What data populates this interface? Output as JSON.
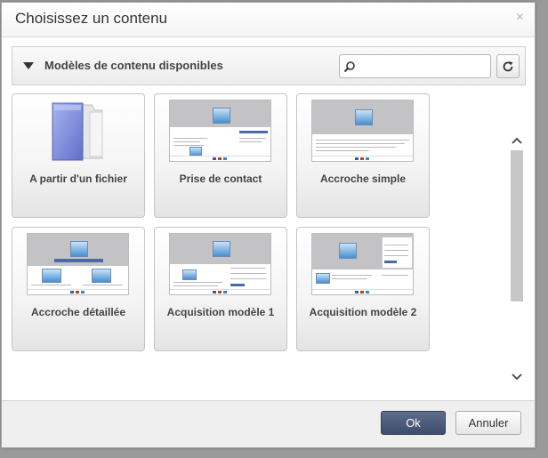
{
  "dialog": {
    "title": "Choisissez un contenu",
    "close_symbol": "×"
  },
  "section": {
    "title": "Modèles de contenu disponibles",
    "search_value": "",
    "search_placeholder": ""
  },
  "templates": [
    {
      "label": "A partir d'un fichier",
      "icon": "folder-icon"
    },
    {
      "label": "Prise de contact",
      "icon": "template-thumbnail"
    },
    {
      "label": "Accroche simple",
      "icon": "template-thumbnail"
    },
    {
      "label": "Accroche détaillée",
      "icon": "template-thumbnail"
    },
    {
      "label": "Acquisition modèle 1",
      "icon": "template-thumbnail"
    },
    {
      "label": "Acquisition modèle 2",
      "icon": "template-thumbnail"
    }
  ],
  "footer": {
    "ok_label": "Ok",
    "cancel_label": "Annuler"
  },
  "colors": {
    "primary_button": "#4a5a7a",
    "folder": "#7f8fd9"
  }
}
